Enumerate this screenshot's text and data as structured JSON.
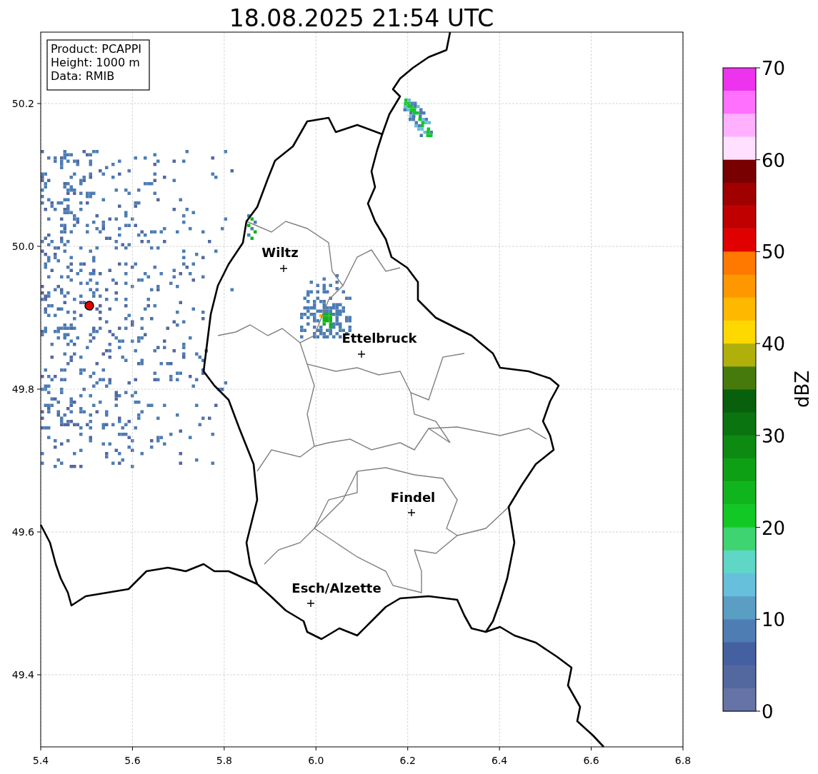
{
  "title": "18.08.2025 21:54 UTC",
  "info_box": [
    "Product: PCAPPI",
    "Height: 1000 m",
    "Data: RMIB"
  ],
  "x_ticks": [
    "5.4",
    "5.6",
    "5.8",
    "6.0",
    "6.2",
    "6.4",
    "6.6",
    "6.8"
  ],
  "y_ticks": [
    "50.2",
    "50.0",
    "49.8",
    "49.6",
    "49.4"
  ],
  "cities": [
    {
      "name": "Wiltz"
    },
    {
      "name": "Ettelbruck"
    },
    {
      "name": "Findel"
    },
    {
      "name": "Esch/Alzette"
    }
  ],
  "colorbar": {
    "label": "dBZ",
    "ticks": [
      "70",
      "60",
      "50",
      "40",
      "30",
      "20",
      "10",
      "0"
    ],
    "segments": [
      {
        "color": "#ee33ee"
      },
      {
        "color": "#ff70ff"
      },
      {
        "color": "#ffb0ff"
      },
      {
        "color": "#ffe0ff"
      },
      {
        "color": "#780000"
      },
      {
        "color": "#a00000"
      },
      {
        "color": "#c00000"
      },
      {
        "color": "#e00000"
      },
      {
        "color": "#ff7800"
      },
      {
        "color": "#ff9800"
      },
      {
        "color": "#ffb800"
      },
      {
        "color": "#ffd800"
      },
      {
        "color": "#b0b00a"
      },
      {
        "color": "#467a0c"
      },
      {
        "color": "#08600c"
      },
      {
        "color": "#0a7410"
      },
      {
        "color": "#0c8a12"
      },
      {
        "color": "#0ea014"
      },
      {
        "color": "#10b41c"
      },
      {
        "color": "#12c824"
      },
      {
        "color": "#3ed470"
      },
      {
        "color": "#60d6c6"
      },
      {
        "color": "#66c0dc"
      },
      {
        "color": "#5b9ec4"
      },
      {
        "color": "#4e7db3"
      },
      {
        "color": "#4460a0"
      },
      {
        "color": "#5468a0"
      },
      {
        "color": "#6573a6"
      }
    ]
  }
}
